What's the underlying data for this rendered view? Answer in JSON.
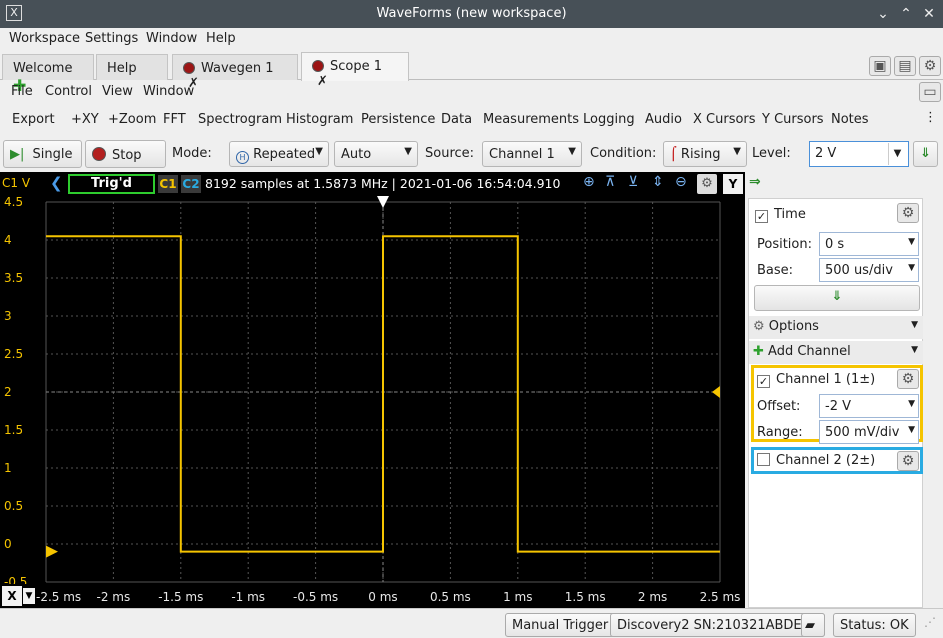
{
  "window": {
    "title": "WaveForms (new workspace)",
    "logo": "X",
    "minimize": "⌄",
    "maximize": "⌃",
    "close": "✕"
  },
  "main_menu": [
    "Workspace",
    "Settings",
    "Window",
    "Help"
  ],
  "tabs": [
    {
      "label": "Welcome",
      "icon": "plus-icon"
    },
    {
      "label": "Help"
    },
    {
      "label": "Wavegen 1",
      "icon": "record-icon",
      "close": "✗"
    },
    {
      "label": "Scope 1",
      "icon": "record-icon",
      "close": "✗",
      "active": true
    }
  ],
  "scope_menu": [
    "File",
    "Control",
    "View",
    "Window"
  ],
  "scope_toolbar": [
    "Export",
    "+XY",
    "+Zoom",
    "FFT",
    "Spectrogram",
    "Histogram",
    "Persistence",
    "Data",
    "Measurements",
    "Logging",
    "Audio",
    "X Cursors",
    "Y Cursors",
    "Notes"
  ],
  "controls": {
    "single_label": "Single",
    "stop_label": "Stop",
    "mode_label": "Mode:",
    "mode_value": "Repeated",
    "trigger_mode_value": "Auto",
    "source_label": "Source:",
    "source_value": "Channel 1",
    "condition_label": "Condition:",
    "condition_value": "Rising",
    "level_label": "Level:",
    "level_value": "2 V"
  },
  "scope_header": {
    "channel_unit": "C1 V",
    "trig_status": "Trig'd",
    "c1": "C1",
    "c2": "C2",
    "info": "8192 samples at 1.5873 MHz | 2021-01-06 16:54:04.910",
    "y_button": "Y"
  },
  "x_button": "X",
  "side": {
    "time_label": "Time",
    "position_label": "Position:",
    "position_value": "0 s",
    "base_label": "Base:",
    "base_value": "500 us/div",
    "options_label": "Options",
    "add_channel_label": "Add Channel",
    "ch1_label": "Channel 1 (1±)",
    "offset_label": "Offset:",
    "offset_value": "-2 V",
    "range_label": "Range:",
    "range_value": "500 mV/div",
    "ch2_label": "Channel 2 (2±)",
    "ch1_color": "#f5c400",
    "ch2_color": "#29abe2"
  },
  "status": {
    "manual_trigger": "Manual Trigger",
    "device": "Discovery2 SN:210321ABDE87",
    "status": "Status: OK"
  },
  "chart_data": {
    "type": "line",
    "x_ticks": [
      "-2.5 ms",
      "-2 ms",
      "-1.5 ms",
      "-1 ms",
      "-0.5 ms",
      "0 ms",
      "0.5 ms",
      "1 ms",
      "1.5 ms",
      "2 ms",
      "2.5 ms"
    ],
    "y_ticks": [
      "4.5",
      "4",
      "3.5",
      "3",
      "2.5",
      "2",
      "1.5",
      "1",
      "0.5",
      "0",
      "-0.5"
    ],
    "xlim": [
      -2.5,
      2.5
    ],
    "ylim": [
      -0.5,
      4.5
    ],
    "series": [
      {
        "color": "#f5c400",
        "x": [
          -2.5,
          -1.5,
          -1.5,
          0,
          0,
          1.0,
          1.0,
          2.5
        ],
        "y": [
          4.05,
          4.05,
          -0.1,
          -0.1,
          4.05,
          4.05,
          -0.1,
          -0.1
        ]
      }
    ],
    "grid": true
  }
}
